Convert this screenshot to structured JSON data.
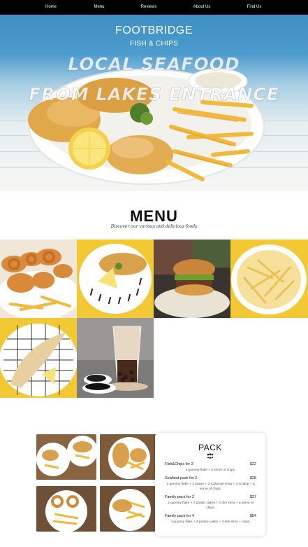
{
  "nav": {
    "items": [
      {
        "label": "Home"
      },
      {
        "label": "Menu"
      },
      {
        "label": "Reviews"
      },
      {
        "label": "About Us"
      },
      {
        "label": "Find Us"
      }
    ]
  },
  "hero": {
    "brand": "FOOTBRIDGE",
    "brand_sub": "FISH & CHIPS",
    "tagline_1": "LOCAL SEAFOOD",
    "tagline_2": "FROM LAKES ENTRANCE"
  },
  "menu": {
    "title": "MENU",
    "subtitle": "Discover our various and delicious foods"
  },
  "pack": {
    "title": "PACK",
    "items": [
      {
        "name": "Fish&Chips for 2",
        "price": "$22",
        "desc": "2 gummy flake + a serve of chips."
      },
      {
        "name": "Seafood pack for 2",
        "price": "$28",
        "desc": "2 gummy flake + 2 prawn + 2 Calamari Ring + 2 scallop + a serve of chips."
      },
      {
        "name": "Family pack for 2",
        "price": "$27",
        "desc": "2 gummy flake + 2 potato cakes + 2 dim sims + a serve of chips."
      },
      {
        "name": "Family pack for 4",
        "price": "$54",
        "desc": "4 gummy flake + 4 potato cakes + 4 dim sims + chips."
      }
    ]
  },
  "colors": {
    "nav_bg": "#000000",
    "hero_sky": "#4c9bcf",
    "tile_yellow": "#f2c935"
  }
}
